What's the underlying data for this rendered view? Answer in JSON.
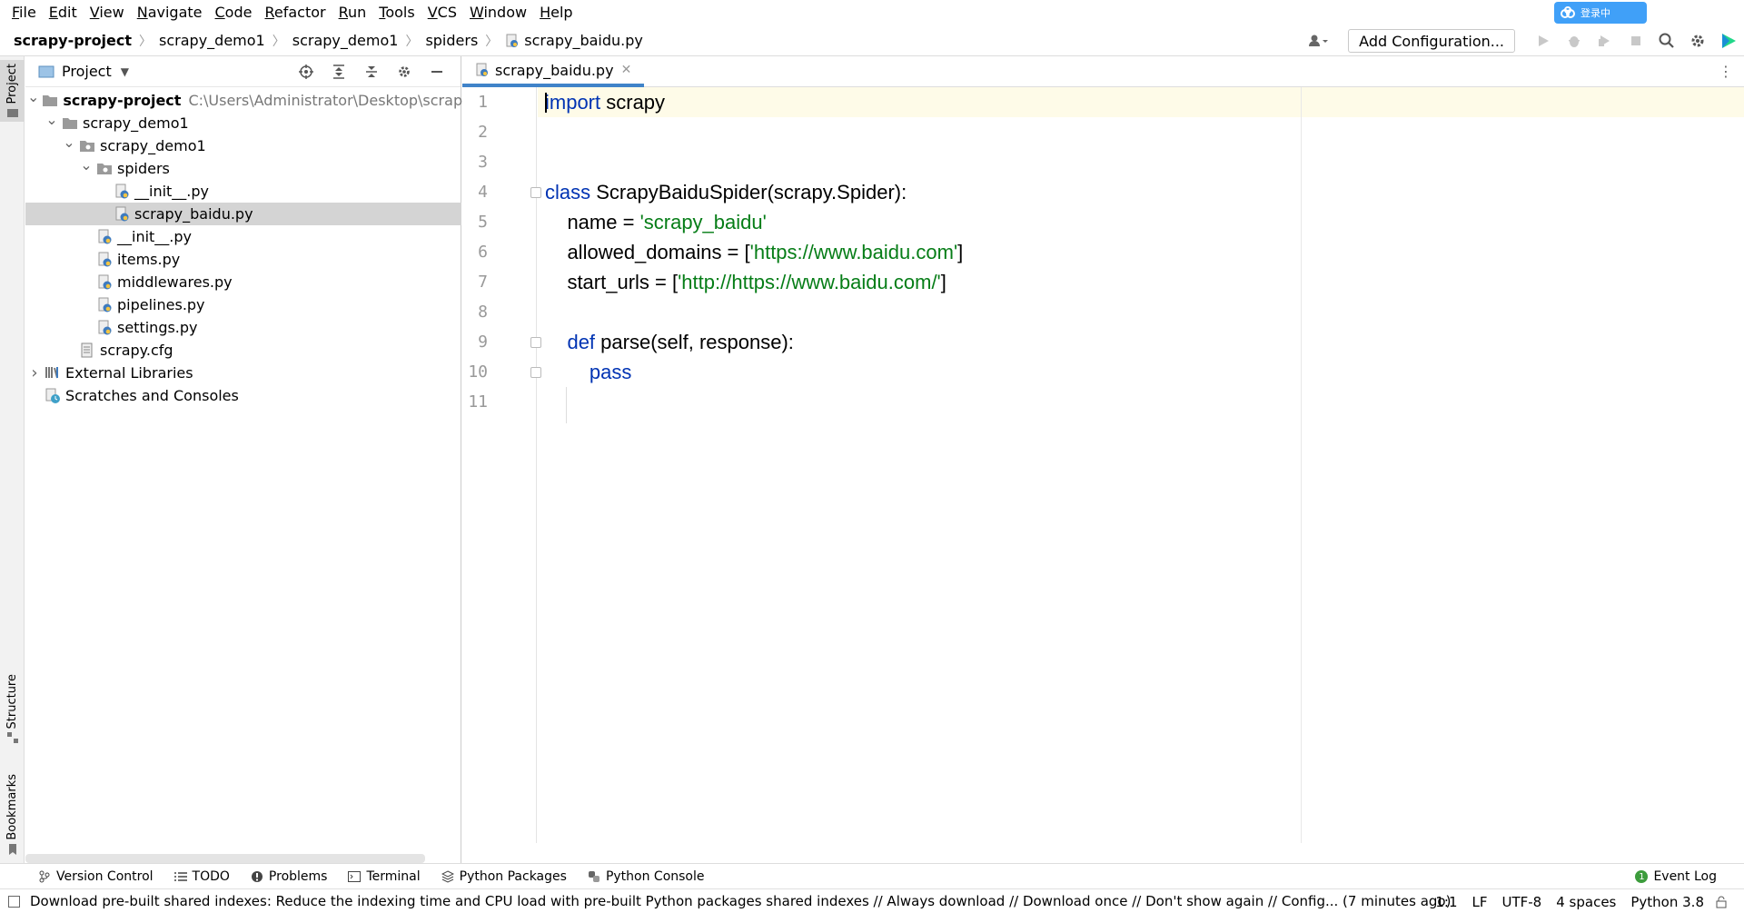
{
  "menu": [
    "File",
    "Edit",
    "View",
    "Navigate",
    "Code",
    "Refactor",
    "Run",
    "Tools",
    "VCS",
    "Window",
    "Help"
  ],
  "cloud_badge": "登录中",
  "breadcrumb": [
    "scrapy-project",
    "scrapy_demo1",
    "scrapy_demo1",
    "spiders",
    "scrapy_baidu.py"
  ],
  "toolbar": {
    "add_configuration": "Add Configuration..."
  },
  "project_panel": {
    "title": "Project",
    "tree": [
      {
        "label": "scrapy-project",
        "path": "C:\\Users\\Administrator\\Desktop\\scrapy-pr",
        "bold": true,
        "depth": 0,
        "type": "folder",
        "expanded": true
      },
      {
        "label": "scrapy_demo1",
        "depth": 1,
        "type": "folder",
        "expanded": true
      },
      {
        "label": "scrapy_demo1",
        "depth": 2,
        "type": "package",
        "expanded": true
      },
      {
        "label": "spiders",
        "depth": 3,
        "type": "package",
        "expanded": true
      },
      {
        "label": "__init__.py",
        "depth": 4,
        "type": "py"
      },
      {
        "label": "scrapy_baidu.py",
        "depth": 4,
        "type": "py",
        "selected": true
      },
      {
        "label": "__init__.py",
        "depth": 3,
        "type": "py"
      },
      {
        "label": "items.py",
        "depth": 3,
        "type": "py"
      },
      {
        "label": "middlewares.py",
        "depth": 3,
        "type": "py"
      },
      {
        "label": "pipelines.py",
        "depth": 3,
        "type": "py"
      },
      {
        "label": "settings.py",
        "depth": 3,
        "type": "py"
      },
      {
        "label": "scrapy.cfg",
        "depth": 2,
        "type": "cfg"
      },
      {
        "label": "External Libraries",
        "depth": 0,
        "type": "lib",
        "collapsed": true
      },
      {
        "label": "Scratches and Consoles",
        "depth": 0,
        "type": "scratch"
      }
    ]
  },
  "side_tabs": {
    "project": "Project",
    "structure": "Structure",
    "bookmarks": "Bookmarks"
  },
  "editor": {
    "tab": "scrapy_baidu.py",
    "lines": [
      [
        {
          "t": "import",
          "c": "kw"
        },
        {
          "t": " scrapy"
        }
      ],
      [],
      [],
      [
        {
          "t": "class",
          "c": "kw"
        },
        {
          "t": " ScrapyBaiduSpider(scrapy.Spider):"
        }
      ],
      [
        {
          "t": "    name = "
        },
        {
          "t": "'scrapy_baidu'",
          "c": "str"
        }
      ],
      [
        {
          "t": "    allowed_domains = ["
        },
        {
          "t": "'https://www.baidu.com'",
          "c": "str"
        },
        {
          "t": "]"
        }
      ],
      [
        {
          "t": "    start_urls = ["
        },
        {
          "t": "'http://https://www.baidu.com/'",
          "c": "str"
        },
        {
          "t": "]"
        }
      ],
      [],
      [
        {
          "t": "    "
        },
        {
          "t": "def",
          "c": "kw"
        },
        {
          "t": " parse(self, response):"
        }
      ],
      [
        {
          "t": "        "
        },
        {
          "t": "pass",
          "c": "kw"
        }
      ],
      []
    ]
  },
  "bottom_tools": [
    "Version Control",
    "TODO",
    "Problems",
    "Terminal",
    "Python Packages",
    "Python Console"
  ],
  "event_log": "Event Log",
  "status": {
    "message": "Download pre-built shared indexes: Reduce the indexing time and CPU load with pre-built Python packages shared indexes // Always download // Download once // Don't show again // Config... (7 minutes ago)",
    "position": "1:1",
    "line_sep": "LF",
    "encoding": "UTF-8",
    "indent": "4 spaces",
    "interpreter": "Python 3.8"
  },
  "colors": {
    "keyword": "#0033b3",
    "string": "#067d17",
    "accent": "#4083c9",
    "selection": "#d4d4d4",
    "current_line": "#fefbe8"
  }
}
